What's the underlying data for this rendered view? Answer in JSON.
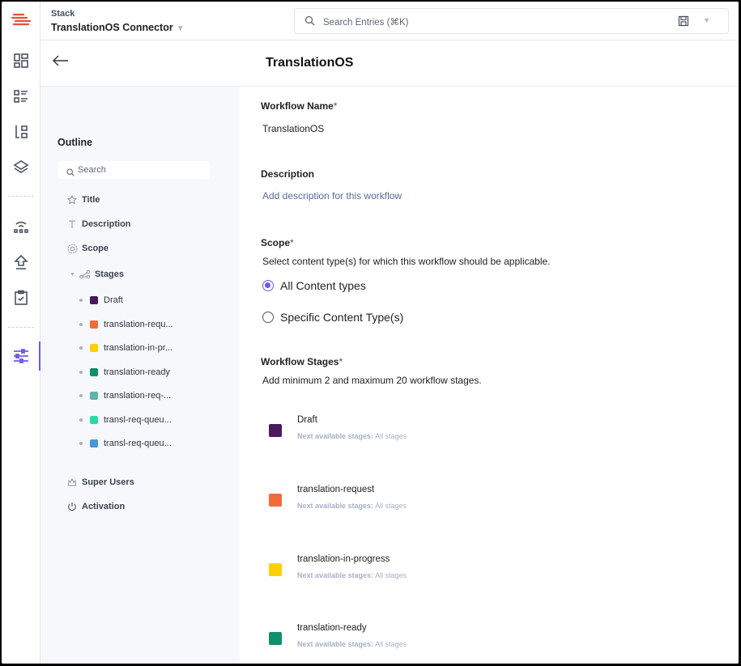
{
  "topbar": {
    "stack_label": "Stack",
    "stack_name": "TranslationOS Connector",
    "search_placeholder": "Search Entries (⌘K)"
  },
  "header": {
    "title": "TranslationOS"
  },
  "outline": {
    "title": "Outline",
    "search_placeholder": "Search",
    "items": {
      "title": "Title",
      "description": "Description",
      "scope": "Scope",
      "stages": "Stages",
      "super_users": "Super Users",
      "activation": "Activation"
    },
    "stages": [
      {
        "label": "Draft",
        "color": "#4a1a5c"
      },
      {
        "label": "translation-requ...",
        "color": "#f26b3a"
      },
      {
        "label": "translation-in-pr...",
        "color": "#ffd000"
      },
      {
        "label": "translation-ready",
        "color": "#0e8f6e"
      },
      {
        "label": "translation-req-...",
        "color": "#5fb3ac"
      },
      {
        "label": "transl-req-queu...",
        "color": "#2ed8a4"
      },
      {
        "label": "transl-req-queu...",
        "color": "#4b97d1"
      }
    ]
  },
  "main": {
    "workflow_name_label": "Workflow Name",
    "workflow_name_value": "TranslationOS",
    "description_label": "Description",
    "description_link": "Add description for this workflow",
    "scope_label": "Scope",
    "scope_help": "Select content type(s) for which this workflow should be applicable.",
    "scope_options": [
      "All Content types",
      "Specific Content Type(s)"
    ],
    "stages_label": "Workflow Stages",
    "stages_help": "Add minimum 2 and maximum 20 workflow stages.",
    "next_label": "Next available stages:",
    "stages": [
      {
        "name": "Draft",
        "next": "All stages",
        "color": "#4a1a5c"
      },
      {
        "name": "translation-request",
        "next": "All stages",
        "color": "#f26b3a"
      },
      {
        "name": "translation-in-progress",
        "next": "All stages",
        "color": "#ffd000"
      },
      {
        "name": "translation-ready",
        "next": "All stages",
        "color": "#0e8f6e"
      }
    ]
  },
  "required_mark": "*",
  "accent_color": "#6c5ce7"
}
